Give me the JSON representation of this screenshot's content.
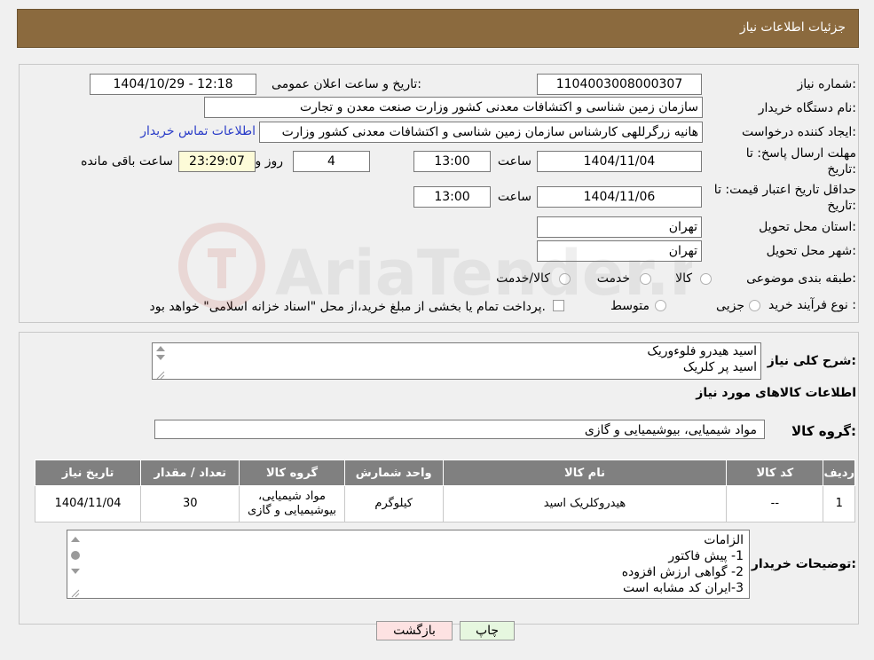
{
  "header": {
    "title": "جزئیات اطلاعات نیاز"
  },
  "form": {
    "need_number_label": "شماره نیاز:",
    "need_number": "1104003008000307",
    "announce_label": "تاریخ و ساعت اعلان عمومی:",
    "announce_value": "1404/10/29 - 12:18",
    "buyer_org_label": "نام دستگاه خریدار:",
    "buyer_org": "سازمان زمین شناسی و اکتشافات معدنی کشور وزارت صنعت معدن و تجارت",
    "creator_label": "ایجاد کننده درخواست:",
    "creator": "هانیه زرگرللهی کارشناس سازمان زمین شناسی و اکتشافات معدنی کشور وزارت",
    "contact_link": "اطلاعات تماس خریدار",
    "reply_deadline_label_1": "مهلت ارسال پاسخ: تا",
    "reply_deadline_label_2": "تاریخ:",
    "reply_date": "1404/11/04",
    "time_label": "ساعت",
    "reply_time": "13:00",
    "days_value": "4",
    "days_label": "روز و",
    "remaining_time": "23:29:07",
    "remaining_label": "ساعت باقی مانده",
    "price_validity_label_1": "حداقل تاریخ اعتبار قیمت: تا",
    "price_validity_label_2": "تاریخ:",
    "price_validity_date": "1404/11/06",
    "price_validity_time": "13:00",
    "province_label": "استان محل تحویل:",
    "province": "تهران",
    "city_label": "شهر محل تحویل:",
    "city": "تهران",
    "category_label": "طبقه بندی موضوعی:",
    "category_options": [
      "کالا",
      "خدمت",
      "کالا/خدمت"
    ],
    "process_label": "نوع فرآیند خرید :",
    "process_options": [
      "جزیی",
      "متوسط"
    ],
    "payment_note": "پرداخت تمام یا بخشی از مبلغ خرید،از محل \"اسناد خزانه اسلامی\" خواهد بود."
  },
  "summary": {
    "label": "شرح کلی نیاز:",
    "lines": [
      "اسید هیدرو فلوءوریک",
      "اسید پر کلریک"
    ]
  },
  "goods_section_title": "اطلاعات کالاهای مورد نیاز",
  "goods_group_label": "گروه کالا:",
  "goods_group": "مواد شیمیایی، بیوشیمیایی و  گازی",
  "table": {
    "headers": [
      "ردیف",
      "کد کالا",
      "نام کالا",
      "واحد شمارش",
      "گروه کالا",
      "تعداد / مقدار",
      "تاریخ نیاز"
    ],
    "rows": [
      [
        "1",
        "--",
        "هیدروکلریک اسید",
        "کیلوگرم",
        "مواد شیمیایی، بیوشیمیایی و گازی",
        "30",
        "1404/11/04"
      ]
    ]
  },
  "buyer_notes": {
    "label": "توضیحات خریدار:",
    "lines": [
      "الزامات",
      "1-  پیش فاکتور",
      "2- گواهی ارزش افزوده",
      "3-ایران کد مشابه است"
    ]
  },
  "buttons": {
    "print": "چاپ",
    "back": "بازگشت"
  },
  "watermark_text": "AriaTender.neT",
  "colors": {
    "header_bg": "#8b6a3e",
    "table_header_bg": "#808080",
    "link": "#2a3cc8",
    "back_btn": "#fde2e2",
    "print_btn": "#e6f7df"
  }
}
